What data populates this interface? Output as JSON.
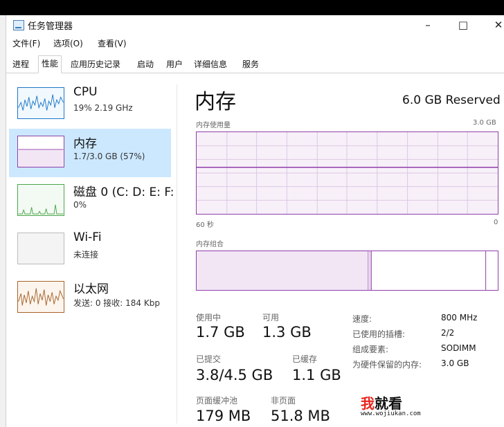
{
  "window": {
    "title": "任务管理器",
    "buttons": {
      "minimize": "–",
      "maximize": "□",
      "close": "✕"
    }
  },
  "menu": [
    "文件(F)",
    "选项(O)",
    "查看(V)"
  ],
  "tabs": [
    "进程",
    "性能",
    "应用历史记录",
    "启动",
    "用户",
    "详细信息",
    "服务"
  ],
  "active_tab": "性能",
  "sidebar": [
    {
      "name": "CPU",
      "sub": "19% 2.19 GHz",
      "icon": "cpu-graph-icon",
      "color": "#1c78c8"
    },
    {
      "name": "内存",
      "sub": "1.7/3.0 GB (57%)",
      "icon": "memory-graph-icon",
      "color": "#8f3ea8",
      "fill": 0.57
    },
    {
      "name": "磁盘 0 (C: D: E: F:",
      "sub": "0%",
      "icon": "disk-graph-icon",
      "color": "#4da64d"
    },
    {
      "name": "Wi-Fi",
      "sub": "未连接",
      "icon": "wifi-graph-icon",
      "color": "#999999"
    },
    {
      "name": "以太网",
      "sub": "发送: 0 接收: 184 Kbp",
      "icon": "ethernet-graph-icon",
      "color": "#a7642a"
    }
  ],
  "main": {
    "title": "内存",
    "reserved": "6.0 GB Reserved",
    "usage_graph": {
      "label": "内存使用量",
      "max": "3.0 GB",
      "time_left": "60 秒",
      "time_right": "0",
      "level": 0.57
    },
    "composition": {
      "label": "内存组合",
      "in_use": 0.57,
      "modified": 0.01,
      "standby": 0.38
    },
    "stats": {
      "in_use_label": "使用中",
      "in_use": "1.7 GB",
      "available_label": "可用",
      "available": "1.3 GB",
      "committed_label": "已提交",
      "committed": "3.8/4.5 GB",
      "cached_label": "已缓存",
      "cached": "1.1 GB",
      "paged_pool_label": "页面缓冲池",
      "paged_pool": "179 MB",
      "nonpaged_pool_label": "非页面",
      "nonpaged_pool": "51.8 MB"
    },
    "info": [
      {
        "label": "速度:",
        "value": "800 MHz"
      },
      {
        "label": "已使用的插槽:",
        "value": "2/2"
      },
      {
        "label": "组成要素:",
        "value": "SODIMM"
      },
      {
        "label": "为硬件保留的内存:",
        "value": "3.0 GB"
      }
    ]
  },
  "watermark": {
    "logo_red": "我",
    "logo_black": "就看",
    "url": "www.wojiukan.com"
  },
  "colors": {
    "memory": "#8f3ea8",
    "memory_fill": "#f7f0f9",
    "selected": "#cce8ff"
  }
}
